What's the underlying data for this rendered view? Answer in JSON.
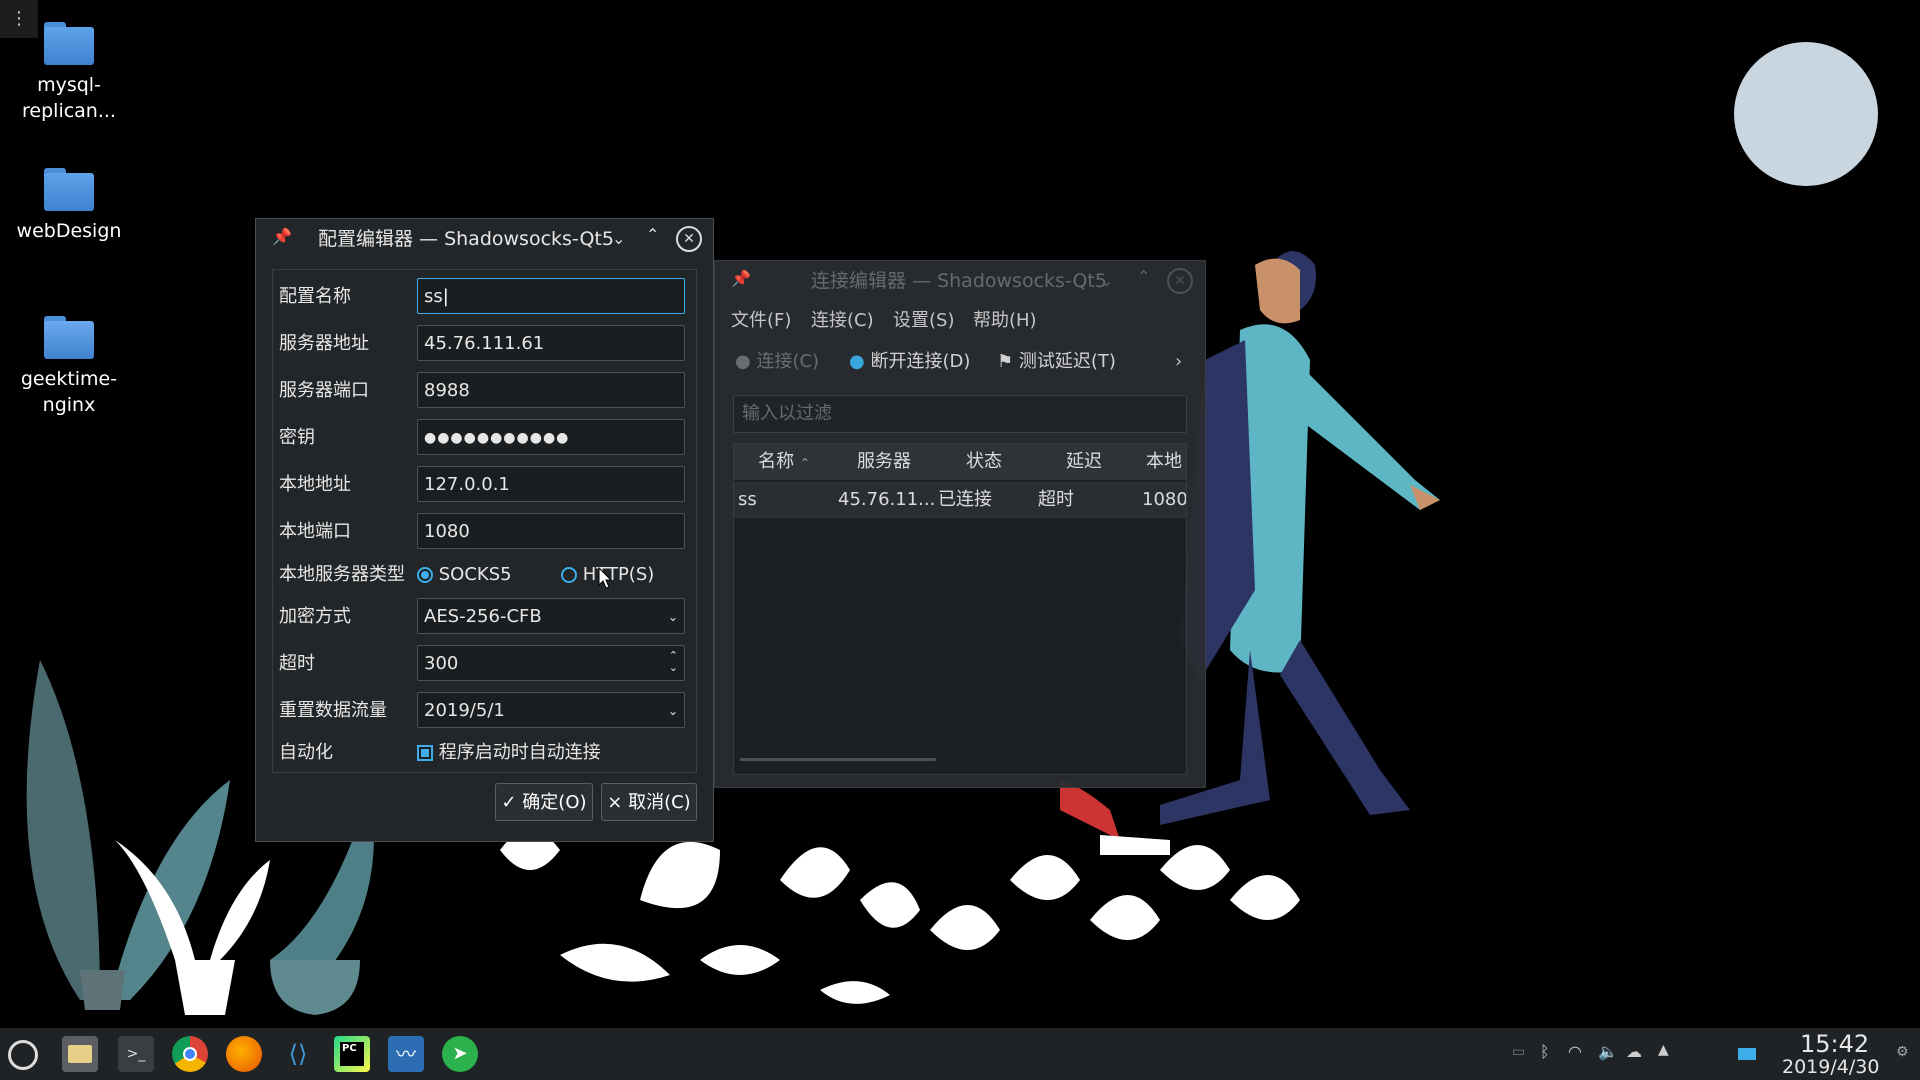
{
  "desktop": {
    "icons": [
      {
        "label": "mysql-\nreplican...",
        "l1": "mysql-",
        "l2": "replican..."
      },
      {
        "label": "webDesign"
      },
      {
        "l1": "geektime-",
        "l2": "nginx"
      }
    ]
  },
  "config_dialog": {
    "title": "配置编辑器 — Shadowsocks-Qt5",
    "fields": {
      "name_label": "配置名称",
      "name_value": "ss",
      "server_label": "服务器地址",
      "server_value": "45.76.111.61",
      "port_label": "服务器端口",
      "port_value": "8988",
      "password_label": "密钥",
      "password_value": "●●●●●●●●●●●",
      "local_addr_label": "本地地址",
      "local_addr_value": "127.0.0.1",
      "local_port_label": "本地端口",
      "local_port_value": "1080",
      "server_type_label": "本地服务器类型",
      "socks5": "SOCKS5",
      "https": "HTTP(S)",
      "encryption_label": "加密方式",
      "encryption_value": "AES-256-CFB",
      "timeout_label": "超时",
      "timeout_value": "300",
      "reset_label": "重置数据流量",
      "reset_value": "2019/5/1",
      "auto_label": "自动化",
      "auto_value": "程序启动时自动连接"
    },
    "ok": "确定(O)",
    "cancel": "取消(C)"
  },
  "conn_window": {
    "title": "连接编辑器 — Shadowsocks-Qt5",
    "menu": [
      "文件(F)",
      "连接(C)",
      "设置(S)",
      "帮助(H)"
    ],
    "toolbar": {
      "connect": "连接(C)",
      "disconnect": "断开连接(D)",
      "test": "测试延迟(T)"
    },
    "filter_placeholder": "输入以过滤",
    "headers": [
      "名称",
      "服务器",
      "状态",
      "延迟",
      "本地"
    ],
    "row": [
      "ss",
      "45.76.11...",
      "已连接",
      "超时",
      "1080"
    ]
  },
  "taskbar": {
    "time": "15:42",
    "date": "2019/4/30"
  },
  "colors": {
    "accent": "#3daee9",
    "window_bg": "#232629",
    "taskbar": "#202326"
  }
}
